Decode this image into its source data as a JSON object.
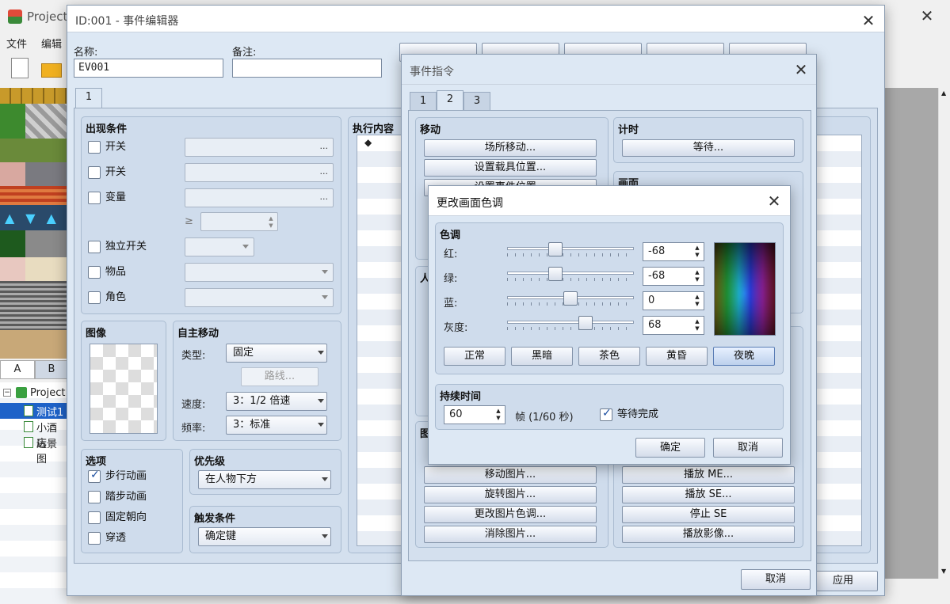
{
  "main_window": {
    "title": "Project",
    "menu": [
      "文件",
      "编辑"
    ],
    "close_glyph": "✕",
    "palette_tabs": [
      "A",
      "B"
    ],
    "tree": [
      {
        "label": "Project"
      },
      {
        "label": "测试1",
        "selected": true
      },
      {
        "label": "小酒店"
      },
      {
        "label": "远景图"
      }
    ]
  },
  "event_editor": {
    "title": "ID:001 - 事件编辑器",
    "name_label": "名称:",
    "name_value": "EV001",
    "note_label": "备注:",
    "note_value": "",
    "page_tab": "1",
    "conditions": {
      "title": "出现条件",
      "items": [
        {
          "label": "开关",
          "kind": "dots",
          "dots": "..."
        },
        {
          "label": "开关",
          "kind": "dots",
          "dots": "..."
        },
        {
          "label": "变量",
          "kind": "dots",
          "dots": "..."
        },
        {
          "label": "独立开关",
          "kind": "combo"
        },
        {
          "label": "物品",
          "kind": "combo"
        },
        {
          "label": "角色",
          "kind": "combo"
        }
      ],
      "ge_symbol": "≥"
    },
    "image": {
      "title": "图像"
    },
    "autonomous": {
      "title": "自主移动",
      "type_label": "类型:",
      "type_value": "固定",
      "route_button": "路线...",
      "speed_label": "速度:",
      "speed_value": "3：1/2 倍速",
      "freq_label": "频率:",
      "freq_value": "3：标准"
    },
    "options": {
      "title": "选项",
      "items": [
        {
          "label": "步行动画",
          "checked": true
        },
        {
          "label": "踏步动画",
          "checked": false
        },
        {
          "label": "固定朝向",
          "checked": false
        },
        {
          "label": "穿透",
          "checked": false
        }
      ]
    },
    "priority": {
      "title": "优先级",
      "value": "在人物下方"
    },
    "trigger": {
      "title": "触发条件",
      "value": "确定键"
    },
    "contents": {
      "title": "执行内容",
      "marker": "◆"
    },
    "apply_button": "应用",
    "close_glyph": "✕"
  },
  "event_commands": {
    "title": "事件指令",
    "tabs": [
      "1",
      "2",
      "3"
    ],
    "active_tab": "2",
    "move_group": {
      "title": "移动",
      "buttons": [
        "场所移动...",
        "设置载具位置...",
        "设置事件位置..."
      ]
    },
    "timing_group": {
      "title": "计时",
      "buttons": [
        "等待..."
      ]
    },
    "screen_group": {
      "title": "画面"
    },
    "char_group": {
      "title": "人"
    },
    "picture_group": {
      "title": "图",
      "buttons": [
        "移动图片...",
        "旋转图片...",
        "更改图片色调...",
        "消除图片..."
      ]
    },
    "audio_buttons": [
      "播放 ME...",
      "播放 SE...",
      "停止 SE",
      "播放影像..."
    ],
    "cancel_button": "取消",
    "close_glyph": "✕"
  },
  "tint_dialog": {
    "title": "更改画面色调",
    "close_glyph": "✕",
    "tone": {
      "title": "色调",
      "channels": [
        {
          "label": "红:",
          "value": "-68",
          "level": -68
        },
        {
          "label": "绿:",
          "value": "-68",
          "level": -68
        },
        {
          "label": "蓝:",
          "value": "0",
          "level": 0
        },
        {
          "label": "灰度:",
          "value": "68",
          "level": 68
        }
      ],
      "presets": [
        "正常",
        "黑暗",
        "茶色",
        "黄昏",
        "夜晚"
      ],
      "selected_preset": "夜晚"
    },
    "duration": {
      "title": "持续时间",
      "value": "60",
      "unit": "帧 (1/60 秒)",
      "wait_label": "等待完成",
      "wait_checked": true
    },
    "ok_button": "确定",
    "cancel_button": "取消",
    "spin_up": "▲",
    "spin_down": "▼"
  },
  "colors": {
    "dialog_bg": "#dde8f4",
    "group_bg": "#cfdcec",
    "selection": "#1e62c8"
  }
}
